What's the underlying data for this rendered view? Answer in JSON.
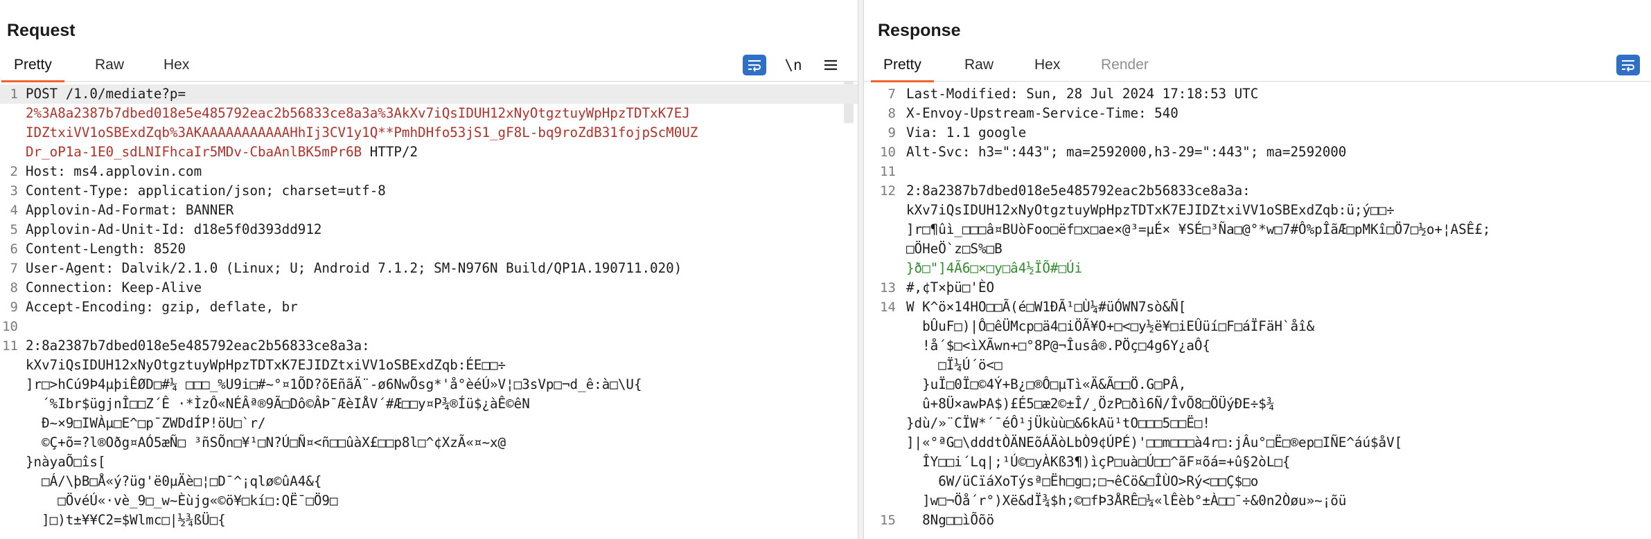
{
  "request": {
    "title": "Request",
    "tabs": [
      "Pretty",
      "Raw",
      "Hex"
    ],
    "newline_label": "\\n",
    "lines": [
      {
        "num": "1",
        "text": "POST /1.0/mediate?p=",
        "hl": true
      },
      {
        "num": "",
        "text": "2%3A8a2387b7dbed018e5e485792eac2b56833ce8a3a%3AkXv7iQsIDUH12xNyOtgztuyWpHpzTDTxK7EJ",
        "cls": "red"
      },
      {
        "num": "",
        "text": "IDZtxiVV1oSBExdZqb%3AKAAAAAAAAAAAHhIj3CV1y1Q**PmhDHfo53jS1_gF8L-bq9roZdB31fojpScM0UZ",
        "cls": "red"
      },
      {
        "num": "",
        "text": "Dr_oP1a-1E0_sdLNIFhcaIr5MDv-CbaAnlBK5mPr6B HTTP/2",
        "mixed": true
      },
      {
        "num": "2",
        "text": "Host: ms4.applovin.com"
      },
      {
        "num": "3",
        "text": "Content-Type: application/json; charset=utf-8"
      },
      {
        "num": "4",
        "text": "Applovin-Ad-Format: BANNER"
      },
      {
        "num": "5",
        "text": "Applovin-Ad-Unit-Id: d18e5f0d393dd912"
      },
      {
        "num": "6",
        "text": "Content-Length: 8520"
      },
      {
        "num": "7",
        "text": "User-Agent: Dalvik/2.1.0 (Linux; U; Android 7.1.2; SM-N976N Build/QP1A.190711.020)"
      },
      {
        "num": "8",
        "text": "Connection: Keep-Alive"
      },
      {
        "num": "9",
        "text": "Accept-Encoding: gzip, deflate, br"
      },
      {
        "num": "10",
        "text": ""
      },
      {
        "num": "11",
        "text": "2:8a2387b7dbed018e5e485792eac2b56833ce8a3a:"
      },
      {
        "num": "",
        "text": "kXv7iQsIDUH12xNyOtgztuyWpHpzTDTxK7EJIDZtxiVV1oSBExdZqb:ÉE□□÷"
      },
      {
        "num": "",
        "text": "]r□>hCú9Þ4µþiÊØD□#¼ □□□_%U9i□#~°¤1ÕD?õEñãÄ¨-ø6NwÕsg*'å°èéÚ»V¦□3sVp□¬d_ê:à□\\U{"
      },
      {
        "num": "",
        "text": "  ´%Ibr$ügjnÎ□□Z´Ê ·*ÌzÔ«NÉÂª®9Ã□Dô©ÂÞ¯ÆèIÅV´#Æ□□y¤P¾®Íü$¿àÊ©êN"
      },
      {
        "num": "",
        "text": "  Ð~×9□IWÀµ□E^□p¯ZWDdÍP!öU□`r/"
      },
      {
        "num": "",
        "text": "  ©Ç+õ=?l®Oðg¤AÓ5æÑ□ ³ñSÕn□¥¹□N?Ú□Ñ¤<ñ□□ûàX£□□p8l□^¢XzÃ«¤~x@"
      },
      {
        "num": "",
        "text": "}nàyaÕ□îs["
      },
      {
        "num": "",
        "text": "  □Á/\\þB□Å«ý?üg'ë0µÄè□¦□D¯^¡qlø©ûA4&{"
      },
      {
        "num": "",
        "text": "    □ÖvéÚ«·vè_9□_w~Èùjg«©ö¥□kí□:QË¯□Ö9□"
      },
      {
        "num": "",
        "text": "  ]□)t±¥¥C2=$Wlmc□|½¾ßÜ□{"
      }
    ]
  },
  "response": {
    "title": "Response",
    "tabs": [
      "Pretty",
      "Raw",
      "Hex",
      "Render"
    ],
    "lines": [
      {
        "num": "7",
        "text": "Last-Modified: Sun, 28 Jul 2024 17:18:53 UTC"
      },
      {
        "num": "8",
        "text": "X-Envoy-Upstream-Service-Time: 540"
      },
      {
        "num": "9",
        "text": "Via: 1.1 google"
      },
      {
        "num": "10",
        "text": "Alt-Svc: h3=\":443\"; ma=2592000,h3-29=\":443\"; ma=2592000"
      },
      {
        "num": "11",
        "text": ""
      },
      {
        "num": "12",
        "text": "2:8a2387b7dbed018e5e485792eac2b56833ce8a3a:"
      },
      {
        "num": "",
        "text": "kXv7iQsIDUH12xNyOtgztuyWpHpzTDTxK7EJIDZtxiVV1oSBExdZqb:ü;ý□□÷"
      },
      {
        "num": "",
        "text": "]r□¶ûì_□□□â¤BUòFoo□ëf□x□ae×@³=µÉ× ¥SÉ□³Ña□@°*w□7#Ô%pÎãÆ□pMKî□Ö7□½o+¦ASÊ£;"
      },
      {
        "num": "",
        "text": "□ÖHeÖ`z□S%□B"
      },
      {
        "num": "",
        "text": "}ð□\"]4Ã6□×□y□â4½ÏÕ#□Úi",
        "cls": "green-mix"
      },
      {
        "num": "13",
        "text": "#,¢T×þü□'ÈO"
      },
      {
        "num": "14",
        "text": "W K^ö×14HO□□Ã(é□W1ÐÃ¹□Ù¼#üÓWN7sò&Ñ["
      },
      {
        "num": "",
        "text": "  bÛuF□)|Ô□êÜMcp□ä4□iÖÃ¥O+□<□y½ë¥□iEÛüí□F□áÏFäH`åî&"
      },
      {
        "num": "",
        "text": "  !å´$□<ìXÃwn+□°8P@¬Îusâ®.PÖç□4g6Y¿aÔ{"
      },
      {
        "num": "",
        "text": "    □Ï¼Ú´ö<□"
      },
      {
        "num": "",
        "text": "  }uÏ□0Ï□©4Ý+B¿□®Ô□µTì«Ä&Ã□□Ö.G□PÂ,"
      },
      {
        "num": "",
        "text": "  û+8Ü×awÞA$)£É5□æ2©±Î/¸ÖzP□ðì6Ñ/ÎvÕ8□ÖÜýÐE÷$¾"
      },
      {
        "num": "",
        "text": "}dù/»¨CÏW*´¯éÔ¹jÜkùù□&6kAü¹tO□□□5□□Ë□!"
      },
      {
        "num": "",
        "text": "]|«°ªG□\\dddtÒÄNEõÁÄòLbÒ9¢ÚPÉ)'□□m□□□à4r□:jÂu°□Ë□®ep□IÑE^áú$åV["
      },
      {
        "num": "",
        "text": "  ÎY□□i´Lq|;¹Ú©□yÀKß3¶)ìçP□uà□Ú□□^ãF¤õá=+û§2òL□{"
      },
      {
        "num": "",
        "text": "    6W/üCïáXoTýsª□Ëh□g□;□¬êCö&□ÎÙO>Rý<□□Ç$□o"
      },
      {
        "num": "",
        "text": "  ]w□¬Öå´r°)Xë&dÏ¾$h;©□fÞ3ÅRÊ□¼«lÊèb°±À□□¯÷&0n2Òøu»~¡õü"
      },
      {
        "num": "15",
        "text": "  8Ng□□ìÕõö"
      }
    ]
  },
  "colors": {
    "accent_orange": "#f0642b",
    "button_blue": "#2f6fc6",
    "string_red": "#b2322a"
  },
  "icons": {
    "wrap": "wrap-lines-icon",
    "newline": "show-newlines-icon",
    "menu": "hamburger-menu-icon",
    "layout": "layout-toggle-icon",
    "cursor": "mouse-cursor-icon"
  }
}
